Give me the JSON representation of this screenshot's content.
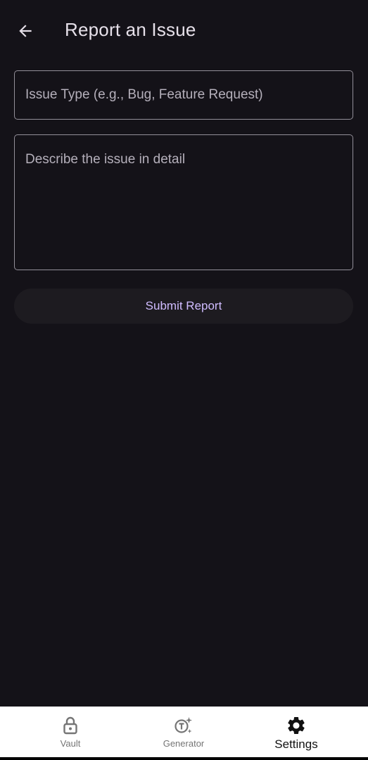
{
  "header": {
    "title": "Report an Issue",
    "back_icon": "arrow-back-icon"
  },
  "form": {
    "issue_type": {
      "placeholder": "Issue Type (e.g., Bug, Feature Request)",
      "value": ""
    },
    "description": {
      "placeholder": "Describe the issue in detail",
      "value": ""
    },
    "submit_label": "Submit Report"
  },
  "bottom_nav": {
    "items": [
      {
        "label": "Vault",
        "icon": "lock-icon",
        "active": false
      },
      {
        "label": "Generator",
        "icon": "generator-icon",
        "active": false
      },
      {
        "label": "Settings",
        "icon": "gear-icon",
        "active": true
      }
    ]
  },
  "colors": {
    "background": "#141218",
    "accent": "#D0BCFF",
    "outline": "#938F99",
    "nav_background": "#FFFFFF"
  }
}
